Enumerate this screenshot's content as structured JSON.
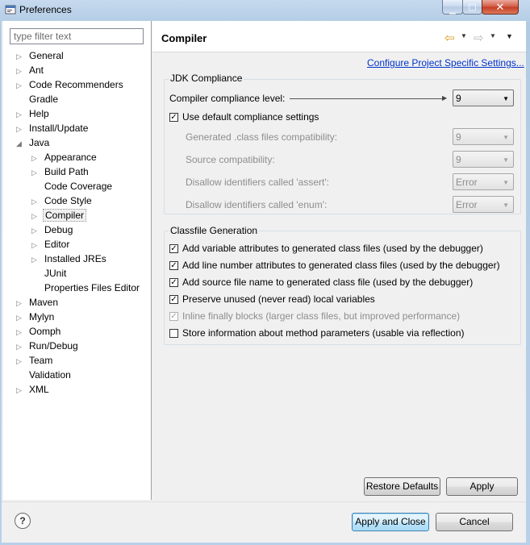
{
  "window": {
    "title": "Preferences"
  },
  "filter": {
    "placeholder": "type filter text"
  },
  "tree": [
    {
      "label": "General",
      "expander": "▷",
      "indent": 0
    },
    {
      "label": "Ant",
      "expander": "▷",
      "indent": 0
    },
    {
      "label": "Code Recommenders",
      "expander": "▷",
      "indent": 0
    },
    {
      "label": "Gradle",
      "expander": "",
      "indent": 0
    },
    {
      "label": "Help",
      "expander": "▷",
      "indent": 0
    },
    {
      "label": "Install/Update",
      "expander": "▷",
      "indent": 0
    },
    {
      "label": "Java",
      "expander": "◢",
      "indent": 0
    },
    {
      "label": "Appearance",
      "expander": "▷",
      "indent": 1
    },
    {
      "label": "Build Path",
      "expander": "▷",
      "indent": 1
    },
    {
      "label": "Code Coverage",
      "expander": "",
      "indent": 1
    },
    {
      "label": "Code Style",
      "expander": "▷",
      "indent": 1
    },
    {
      "label": "Compiler",
      "expander": "▷",
      "indent": 1,
      "selected": true
    },
    {
      "label": "Debug",
      "expander": "▷",
      "indent": 1
    },
    {
      "label": "Editor",
      "expander": "▷",
      "indent": 1
    },
    {
      "label": "Installed JREs",
      "expander": "▷",
      "indent": 1
    },
    {
      "label": "JUnit",
      "expander": "",
      "indent": 1
    },
    {
      "label": "Properties Files Editor",
      "expander": "",
      "indent": 1
    },
    {
      "label": "Maven",
      "expander": "▷",
      "indent": 0
    },
    {
      "label": "Mylyn",
      "expander": "▷",
      "indent": 0
    },
    {
      "label": "Oomph",
      "expander": "▷",
      "indent": 0
    },
    {
      "label": "Run/Debug",
      "expander": "▷",
      "indent": 0
    },
    {
      "label": "Team",
      "expander": "▷",
      "indent": 0
    },
    {
      "label": "Validation",
      "expander": "",
      "indent": 0
    },
    {
      "label": "XML",
      "expander": "▷",
      "indent": 0
    }
  ],
  "page": {
    "title": "Compiler",
    "config_link": "Configure Project Specific Settings..."
  },
  "jdk": {
    "group_label": "JDK Compliance",
    "compliance_label": "Compiler compliance level:",
    "compliance_value": "9",
    "use_default_label": "Use default compliance settings",
    "use_default_checked": true,
    "generated_label": "Generated .class files compatibility:",
    "generated_value": "9",
    "source_label": "Source compatibility:",
    "source_value": "9",
    "assert_label": "Disallow identifiers called 'assert':",
    "assert_value": "Error",
    "enum_label": "Disallow identifiers called 'enum':",
    "enum_value": "Error"
  },
  "classfile": {
    "group_label": "Classfile Generation",
    "options": [
      {
        "label": "Add variable attributes to generated class files (used by the debugger)",
        "checked": true,
        "enabled": true
      },
      {
        "label": "Add line number attributes to generated class files (used by the debugger)",
        "checked": true,
        "enabled": true
      },
      {
        "label": "Add source file name to generated class file (used by the debugger)",
        "checked": true,
        "enabled": true
      },
      {
        "label": "Preserve unused (never read) local variables",
        "checked": true,
        "enabled": true
      },
      {
        "label": "Inline finally blocks (larger class files, but improved performance)",
        "checked": true,
        "enabled": false
      },
      {
        "label": "Store information about method parameters (usable via reflection)",
        "checked": false,
        "enabled": true
      }
    ]
  },
  "buttons": {
    "restore_defaults": "Restore Defaults",
    "apply": "Apply",
    "apply_and_close": "Apply and Close",
    "cancel": "Cancel",
    "help": "?"
  },
  "icons": {
    "window": "preferences-window-icon",
    "back": "back-arrow-icon",
    "forward": "forward-arrow-icon",
    "menu": "view-menu-icon",
    "help": "help-icon"
  },
  "colors": {
    "link": "#0033cc",
    "back_arrow": "#d89a1c",
    "close_button": "#c43b22"
  }
}
